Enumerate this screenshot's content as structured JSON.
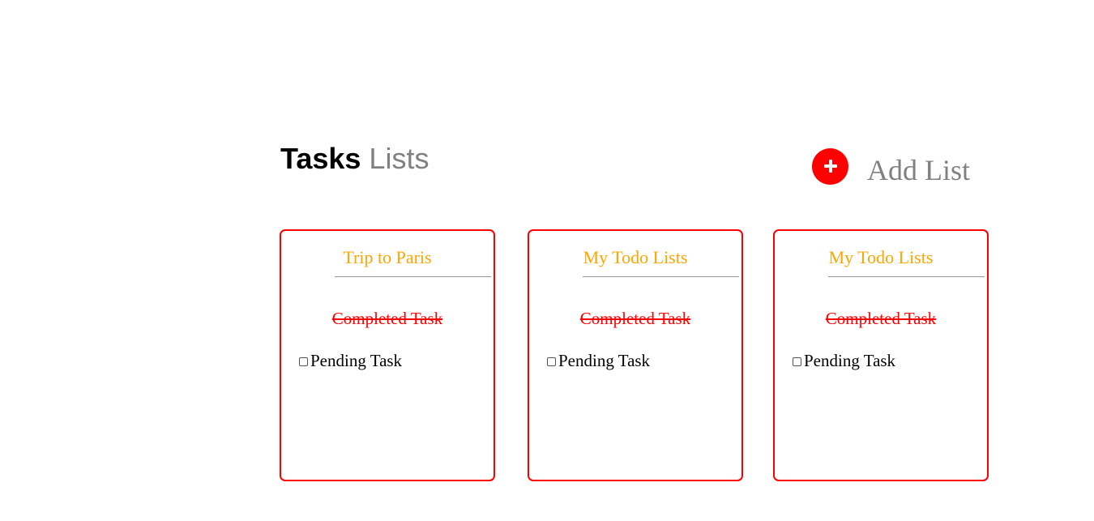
{
  "header": {
    "title_strong": "Tasks",
    "title_light": "Lists"
  },
  "add_list": {
    "icon": "plus-circle-icon",
    "label": "Add List"
  },
  "lists": [
    {
      "title": "Trip to Paris",
      "completed_task": "Completed Task",
      "pending_task": "Pending Task",
      "pending_checked": false
    },
    {
      "title": "My Todo Lists",
      "completed_task": "Completed Task",
      "pending_task": "Pending Task",
      "pending_checked": false
    },
    {
      "title": "My Todo Lists",
      "completed_task": "Completed Task",
      "pending_task": "Pending Task",
      "pending_checked": false
    }
  ],
  "colors": {
    "accent_red": "#ff0000",
    "card_title": "#ffa500",
    "muted_text": "#808080"
  }
}
